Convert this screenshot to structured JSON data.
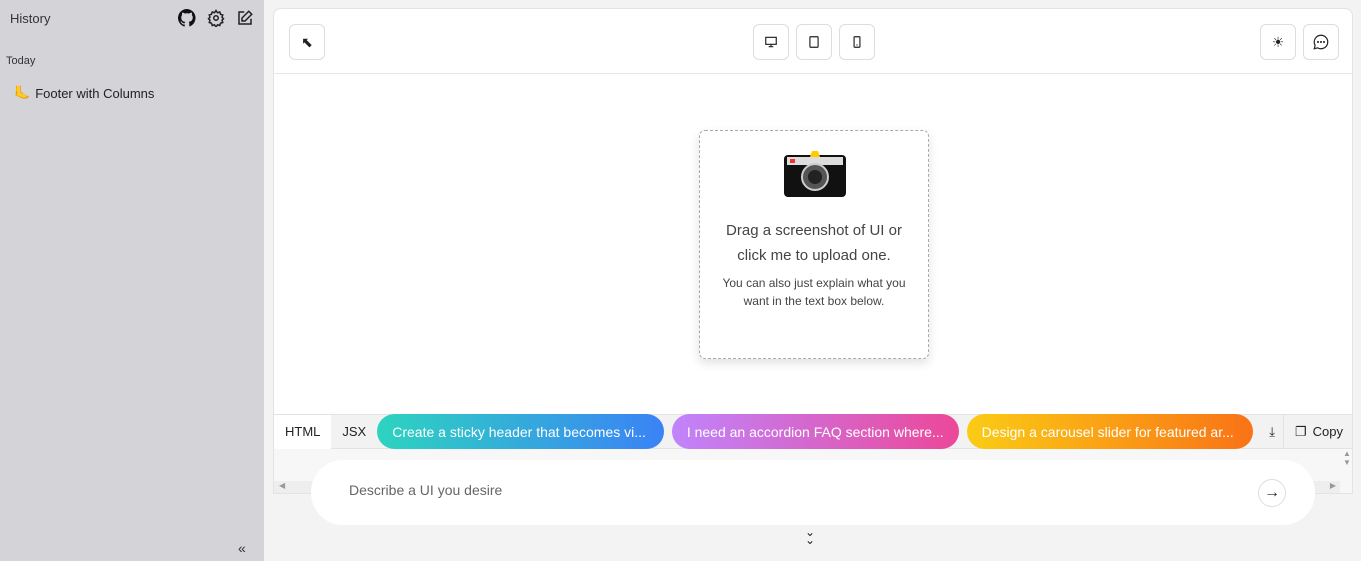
{
  "sidebar": {
    "title": "History",
    "section": "Today",
    "items": [
      {
        "label": "Footer with Columns",
        "icon": "foot-emoji"
      }
    ],
    "icons": [
      "github-icon",
      "gear-icon",
      "edit-icon"
    ],
    "collapse": "«"
  },
  "toolbar": {
    "left": "select-cursor-icon",
    "devices": [
      "desktop-icon",
      "tablet-icon",
      "mobile-icon"
    ],
    "right": [
      "sun-icon",
      "chat-icon"
    ]
  },
  "upload": {
    "heading": "Drag a screenshot of UI or click me to upload one.",
    "sub": "You can also just explain what you want in the text box below."
  },
  "tabs": [
    "HTML",
    "JSX"
  ],
  "suggestions": [
    "Create a sticky header that becomes vi...",
    "I need an accordion FAQ section where...",
    "Design a carousel slider for featured ar..."
  ],
  "actions": {
    "copy": "Copy"
  },
  "prompt": {
    "placeholder": "Describe a UI you desire"
  }
}
